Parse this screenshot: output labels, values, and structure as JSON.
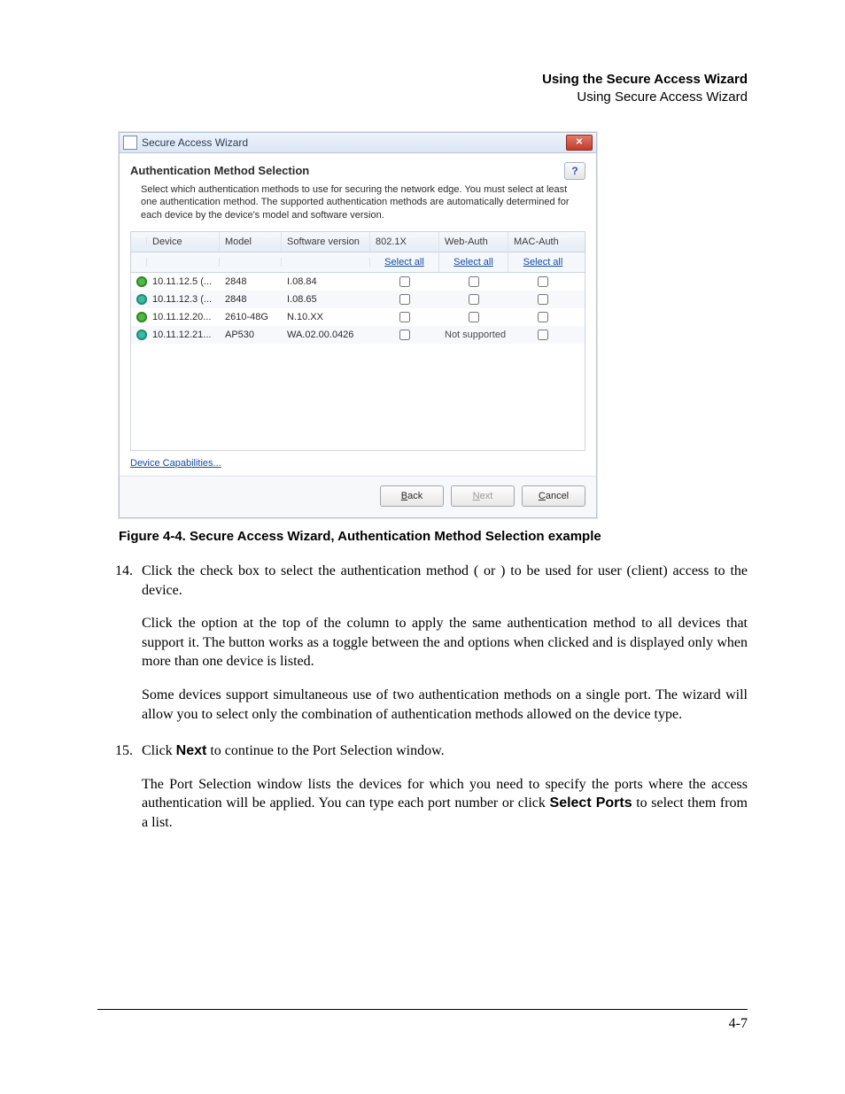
{
  "header": {
    "title_bold": "Using the Secure Access Wizard",
    "subtitle": "Using Secure Access Wizard"
  },
  "wizard": {
    "window_title": "Secure Access Wizard",
    "close_glyph": "✕",
    "heading": "Authentication Method Selection",
    "help_glyph": "?",
    "description": "Select which authentication methods to use for securing the network edge. You must select at least one authentication method. The supported authentication methods are automatically determined for each device by the device's model and software version.",
    "columns": {
      "device": "Device",
      "model": "Model",
      "swver": "Software version",
      "c8021x": "802.1X",
      "webauth": "Web-Auth",
      "macauth": "MAC-Auth"
    },
    "select_all": "Select all",
    "rows": [
      {
        "status": "green",
        "device": "10.11.12.5 (...",
        "model": "2848",
        "sw": "I.08.84",
        "c8021x": "cb",
        "webauth": "cb",
        "macauth": "cb"
      },
      {
        "status": "teal",
        "device": "10.11.12.3 (...",
        "model": "2848",
        "sw": "I.08.65",
        "c8021x": "cb",
        "webauth": "cb",
        "macauth": "cb"
      },
      {
        "status": "green",
        "device": "10.11.12.20...",
        "model": "2610-48G",
        "sw": "N.10.XX",
        "c8021x": "cb",
        "webauth": "cb",
        "macauth": "cb"
      },
      {
        "status": "teal",
        "device": "10.11.12.21...",
        "model": "AP530",
        "sw": "WA.02.00.0426",
        "c8021x": "cb",
        "webauth": "ns",
        "macauth": "cb"
      }
    ],
    "not_supported": "Not supported",
    "device_capabilities": "Device Capabilities...",
    "buttons": {
      "back": "Back",
      "next": "Next",
      "cancel": "Cancel"
    }
  },
  "figure_caption": "Figure 4-4. Secure Access Wizard, Authentication Method Selection example",
  "steps": [
    {
      "num": "14.",
      "paras": [
        "Click the check box to select the authentication method ( or ) to be used for user (client) access to the device.",
        "Click the option at the top of the column to apply the same authentication method to all devices that support it. The button works as a toggle between the and options when clicked and is displayed only when more than one device is listed.",
        "Some devices support simultaneous use of two authentication methods on a single port. The wizard will allow you to select only the combination of authentication methods allowed on the device type."
      ]
    },
    {
      "num": "15.",
      "paras": [
        "Click <b>Next</b> to continue to the Port Selection window.",
        "The Port Selection window lists the devices for which you need to specify the ports where the access authentication will be applied. You can type each port number or click <b>Select Ports</b> to select them from a list."
      ]
    }
  ],
  "page_number": "4-7"
}
